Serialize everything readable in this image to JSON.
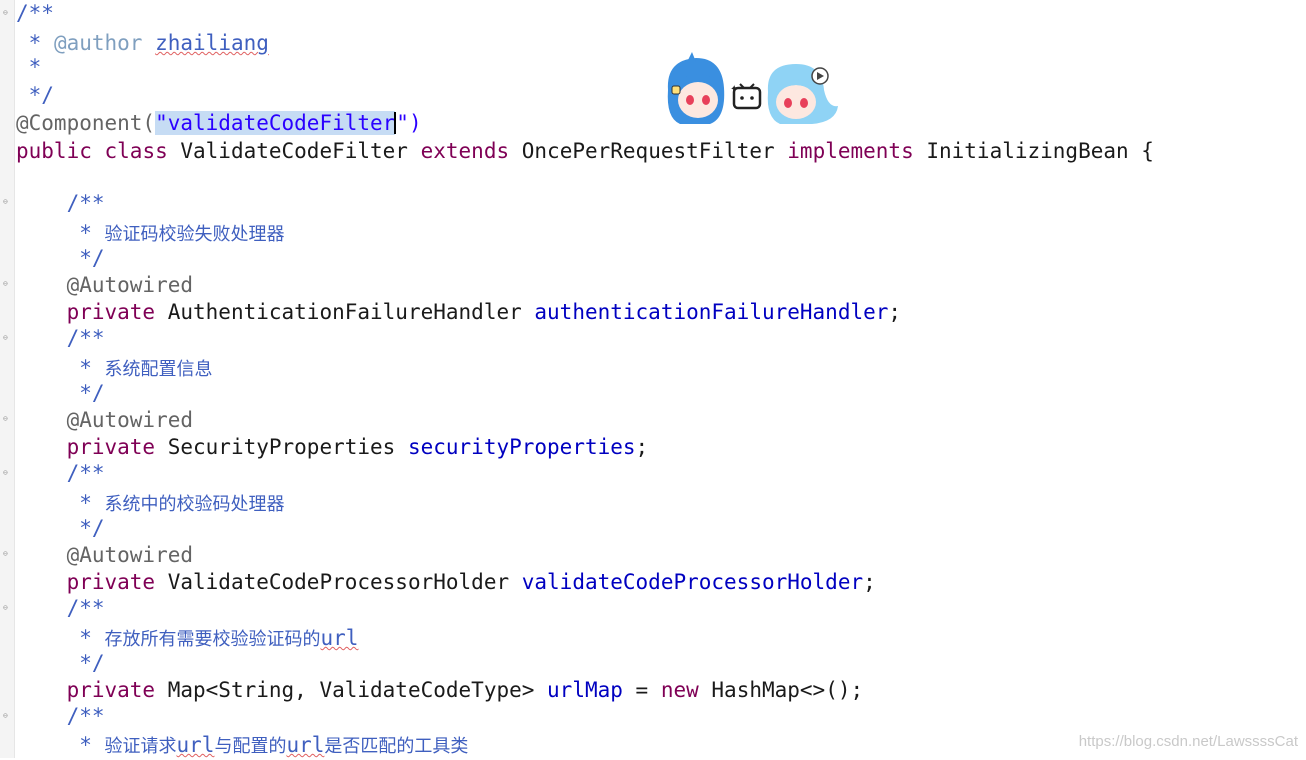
{
  "lines": {
    "l1": {
      "a": "/**"
    },
    "l2": {
      "a": " * ",
      "b": "@author",
      "c": " ",
      "d": "zhailiang"
    },
    "l3": {
      "a": " *"
    },
    "l4": {
      "a": " */"
    },
    "l5": {
      "a": "@Component(",
      "b": "\"validateCodeFilter",
      "c": "\")"
    },
    "l6": {
      "a": "public",
      "b": " ",
      "c": "class",
      "d": " ValidateCodeFilter ",
      "e": "extends",
      "f": " OncePerRequestFilter ",
      "g": "implements",
      "h": " InitializingBean {"
    },
    "l7": {
      "a": "    /**"
    },
    "l8": {
      "a": "     * ",
      "b": "验证码校验失败处理器"
    },
    "l9": {
      "a": "     */"
    },
    "l10": {
      "a": "    @Autowired"
    },
    "l11": {
      "a": "    ",
      "b": "private",
      "c": " AuthenticationFailureHandler ",
      "d": "authenticationFailureHandler",
      "e": ";"
    },
    "l12": {
      "a": "    /**"
    },
    "l13": {
      "a": "     * ",
      "b": "系统配置信息"
    },
    "l14": {
      "a": "     */"
    },
    "l15": {
      "a": "    @Autowired"
    },
    "l16": {
      "a": "    ",
      "b": "private",
      "c": " SecurityProperties ",
      "d": "securityProperties",
      "e": ";"
    },
    "l17": {
      "a": "    /**"
    },
    "l18": {
      "a": "     * ",
      "b": "系统中的校验码处理器"
    },
    "l19": {
      "a": "     */"
    },
    "l20": {
      "a": "    @Autowired"
    },
    "l21": {
      "a": "    ",
      "b": "private",
      "c": " ValidateCodeProcessorHolder ",
      "d": "validateCodeProcessorHolder",
      "e": ";"
    },
    "l22": {
      "a": "    /**"
    },
    "l23": {
      "a": "     * ",
      "b": "存放所有需要校验验证码的",
      "c": "url"
    },
    "l24": {
      "a": "     */"
    },
    "l25": {
      "a": "    ",
      "b": "private",
      "c": " Map<String, ValidateCodeType> ",
      "d": "urlMap",
      "e": " = ",
      "f": "new",
      "g": " HashMap<>();"
    },
    "l26": {
      "a": "    /**"
    },
    "l27": {
      "a": "     * ",
      "b": "验证请求",
      "c": "url",
      "d": "与配置的",
      "e": "url",
      "f": "是否匹配的工具类"
    }
  },
  "watermark": "https://blog.csdn.net/LawssssCat",
  "icons": {
    "mascots": "bilibili-mascots-icon",
    "fold": "fold-marker-icon"
  }
}
